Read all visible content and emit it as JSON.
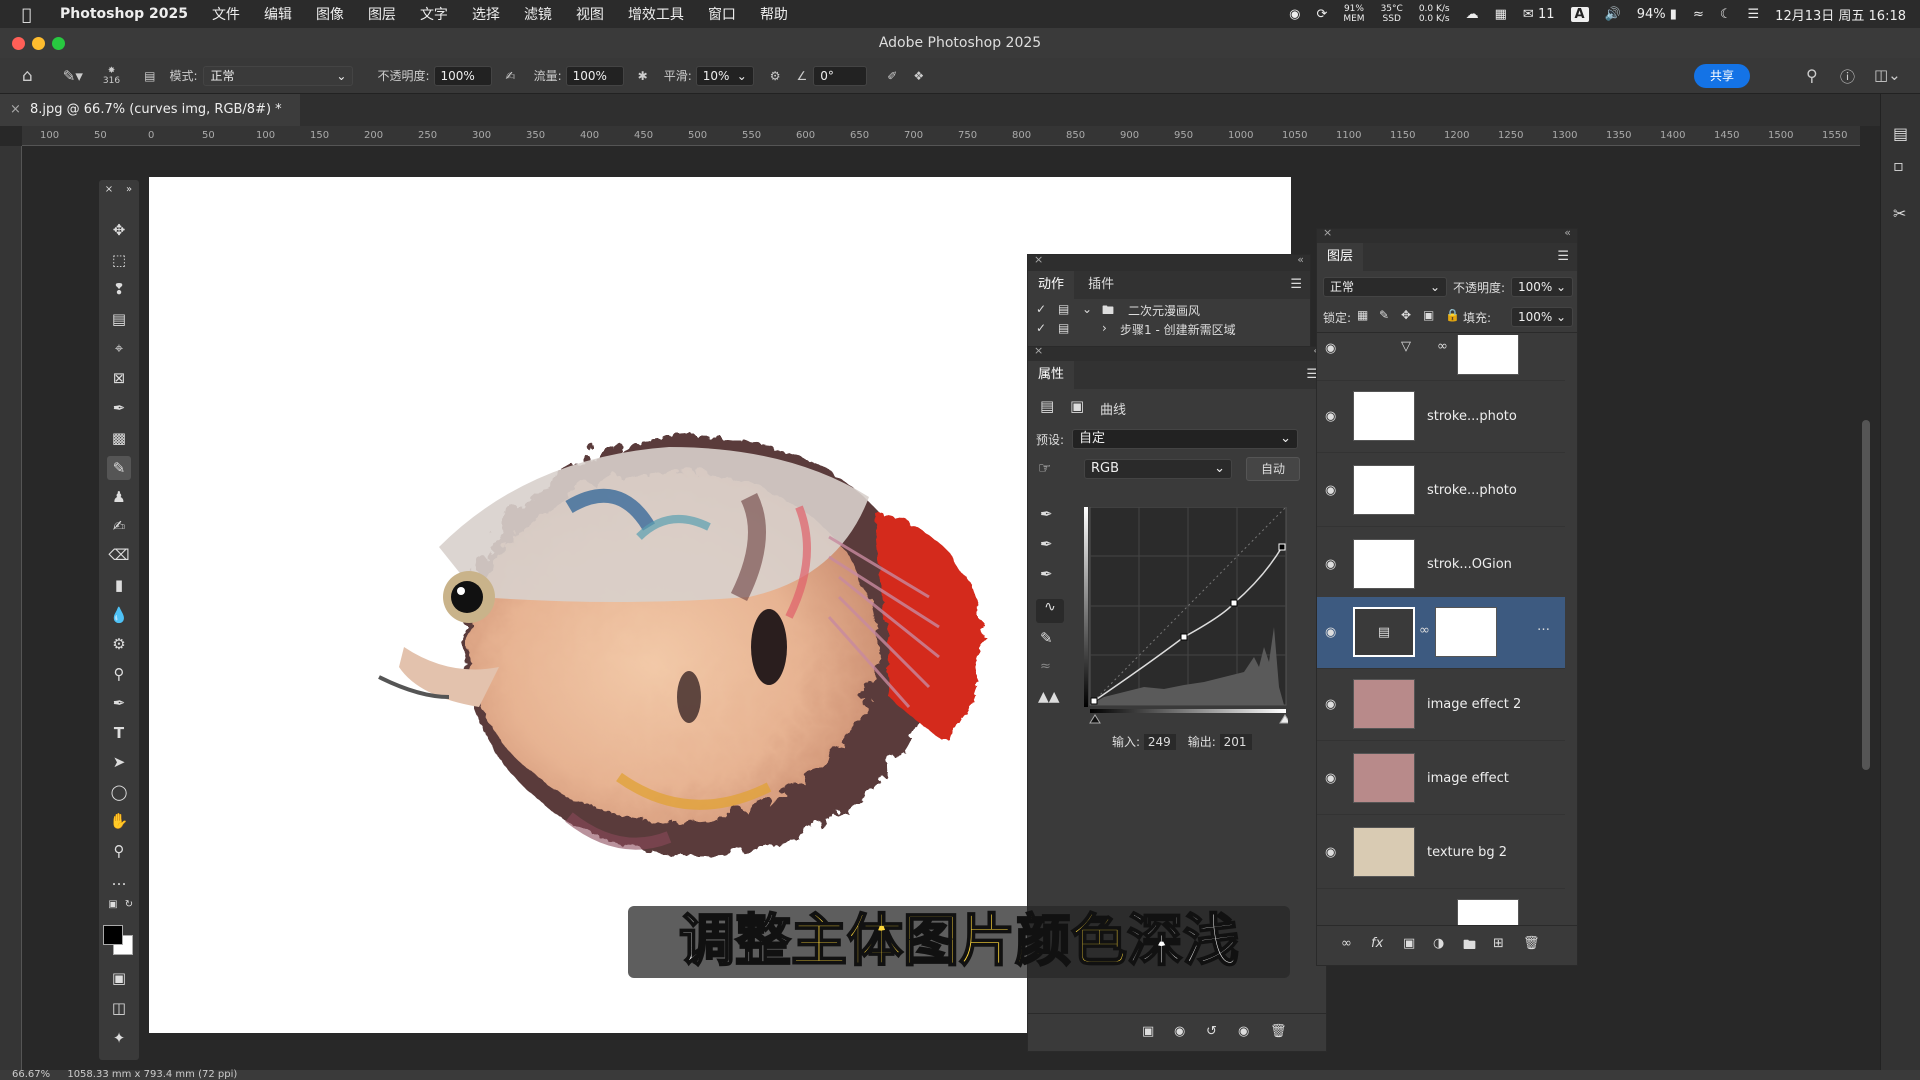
{
  "menubar": {
    "app_name": "Photoshop 2025",
    "items": [
      "文件",
      "编辑",
      "图像",
      "图层",
      "文字",
      "选择",
      "滤镜",
      "视图",
      "增效工具",
      "窗口",
      "帮助"
    ],
    "cpu": "91%",
    "cpu_sub": "MEM",
    "temp": "35°C",
    "temp_sub": "SSD",
    "net_up": "0.0 K/s",
    "net_down": "0.0 K/s",
    "wechat_badge": "11",
    "input_method": "A",
    "battery": "94%",
    "clock": "12月13日 周五 16:18"
  },
  "window": {
    "title": "Adobe Photoshop 2025"
  },
  "options": {
    "brush_size": "316",
    "mode_label": "模式:",
    "mode_value": "正常",
    "opacity_label": "不透明度:",
    "opacity_value": "100%",
    "flow_label": "流量:",
    "flow_value": "100%",
    "smooth_label": "平滑:",
    "smooth_value": "10%",
    "angle_value": "0°",
    "share_label": "共享"
  },
  "document": {
    "tab_label": "8.jpg @ 66.7% (curves img, RGB/8#) *"
  },
  "ruler": {
    "ticks": [
      "100",
      "50",
      "0",
      "50",
      "100",
      "150",
      "200",
      "250",
      "300",
      "350",
      "400",
      "450",
      "500",
      "550",
      "600",
      "650",
      "700",
      "750",
      "800",
      "850",
      "900",
      "950",
      "1000",
      "1050",
      "1100",
      "1150",
      "1200",
      "1250",
      "1300",
      "1350",
      "1400",
      "1450",
      "1500",
      "1550"
    ]
  },
  "actions_panel": {
    "tabs": [
      "动作",
      "插件"
    ],
    "set_name": "二次元漫画风",
    "step_name": "步骤1 - 创建新需区域"
  },
  "properties_panel": {
    "tab": "属性",
    "adjustment_name": "曲线",
    "preset_label": "预设:",
    "preset_value": "自定",
    "channel_value": "RGB",
    "auto_label": "自动",
    "input_label": "输入:",
    "input_value": "249",
    "output_label": "输出:",
    "output_value": "201"
  },
  "layers_panel": {
    "tab": "图层",
    "blend_mode": "正常",
    "opacity_label": "不透明度:",
    "opacity_value": "100%",
    "lock_label": "锁定:",
    "fill_label": "填充:",
    "fill_value": "100%",
    "layers": [
      {
        "name": "stroke...photo"
      },
      {
        "name": "stroke...photo"
      },
      {
        "name": "strok...OGion"
      },
      {
        "name": ""
      },
      {
        "name": "image effect 2"
      },
      {
        "name": "image effect"
      },
      {
        "name": "texture bg 2"
      }
    ]
  },
  "subtitle": {
    "part1": "调整",
    "part2": "主体图片颜色",
    "part3": "深浅"
  },
  "status": {
    "zoom": "66.67%",
    "doc_size": "1058.33 mm x 793.4 mm (72 ppi)"
  },
  "colors": {
    "accent": "#1473e6",
    "selected_layer": "#3d5a80",
    "subtitle_highlight": "#ffd83a"
  }
}
